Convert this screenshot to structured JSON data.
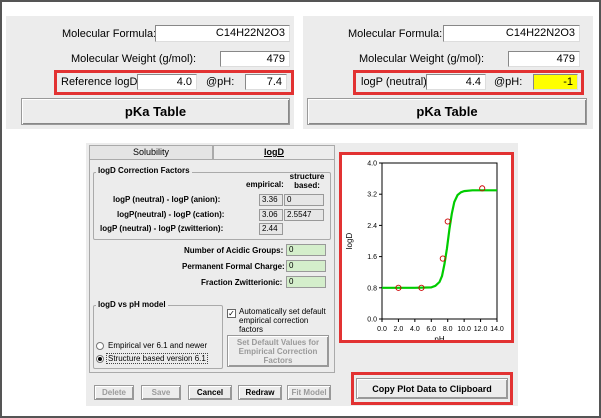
{
  "left_panel": {
    "molecular_formula_label": "Molecular Formula:",
    "molecular_formula_value": "C14H22N2O3",
    "molecular_weight_label": "Molecular Weight (g/mol):",
    "molecular_weight_value": "479",
    "reference_logd_label": "Reference logD:",
    "reference_logd_value": "4.0",
    "ph_label": "@pH:",
    "ph_value": "7.4",
    "pka_table_button": "pKa Table"
  },
  "right_panel": {
    "molecular_formula_label": "Molecular Formula:",
    "molecular_formula_value": "C14H22N2O3",
    "molecular_weight_label": "Molecular Weight (g/mol):",
    "molecular_weight_value": "479",
    "logp_neutral_label": "logP (neutral):",
    "logp_neutral_value": "4.4",
    "ph_label": "@pH:",
    "ph_value": "-1",
    "ph_highlight_color": "#ffff00",
    "pka_table_button": "pKa Table"
  },
  "dialog": {
    "tabs": [
      "Solubility",
      "logD"
    ],
    "correction_factors": {
      "title": "logD Correction Factors",
      "col_empirical": "empirical:",
      "col_structure": "structure\nbased:",
      "rows": [
        {
          "label": "logP (neutral) - logP (anion):",
          "empirical": "3.36",
          "structure": "0"
        },
        {
          "label": "logP(neutral) - logP (cation):",
          "empirical": "3.06",
          "structure": "2.5547"
        },
        {
          "label": "logP (neutral) - logP (zwitterion):",
          "empirical": "2.44",
          "structure": ""
        }
      ]
    },
    "groups": [
      {
        "label": "Number of Acidic Groups:",
        "value": "0"
      },
      {
        "label": "Permanent Formal Charge:",
        "value": "0"
      },
      {
        "label": "Fraction Zwitterionic:",
        "value": "0"
      }
    ],
    "model": {
      "title": "logD vs pH model",
      "options": [
        "Empirical ver 6.1 and newer",
        "Structure based version 6.1"
      ],
      "selected": 1
    },
    "auto_checkbox_label": "Automatically set default empirical correction factors",
    "auto_checked": true,
    "set_default_button": "Set Default Values for Empirical Correction Factors",
    "buttons": {
      "delete": "Delete",
      "save": "Save",
      "cancel": "Cancel",
      "redraw": "Redraw",
      "fit_model": "Fit Model"
    },
    "copy_plot_button": "Copy Plot Data to Clipboard"
  },
  "chart_data": {
    "type": "line",
    "xlabel": "pH",
    "ylabel": "logD",
    "xlim": [
      0.0,
      14.0
    ],
    "ylim": [
      0.0,
      4.0
    ],
    "xticks": [
      "0.0",
      "2.0",
      "4.0",
      "6.0",
      "8.0",
      "10.0",
      "12.0",
      "14.0"
    ],
    "yticks": [
      "0.0",
      "0.8",
      "1.6",
      "2.4",
      "3.2",
      "4.0"
    ],
    "curve": {
      "low_plateau": 0.8,
      "high_plateau": 3.3,
      "x": [
        0.0,
        2.0,
        4.0,
        6.0,
        6.5,
        7.0,
        7.3,
        7.6,
        7.9,
        8.2,
        8.5,
        8.8,
        9.2,
        9.6,
        10.0,
        11.0,
        12.0,
        13.0,
        14.0
      ],
      "y": [
        0.8,
        0.8,
        0.8,
        0.81,
        0.85,
        0.95,
        1.1,
        1.4,
        1.8,
        2.3,
        2.7,
        3.0,
        3.18,
        3.25,
        3.28,
        3.3,
        3.3,
        3.3,
        3.3
      ],
      "color": "#00cc00"
    },
    "points": [
      {
        "x": 2.0,
        "y": 0.8
      },
      {
        "x": 4.8,
        "y": 0.8
      },
      {
        "x": 7.4,
        "y": 1.55
      },
      {
        "x": 8.0,
        "y": 2.5
      },
      {
        "x": 12.2,
        "y": 3.35
      }
    ],
    "point_color": "#cc0000",
    "grid": false
  }
}
